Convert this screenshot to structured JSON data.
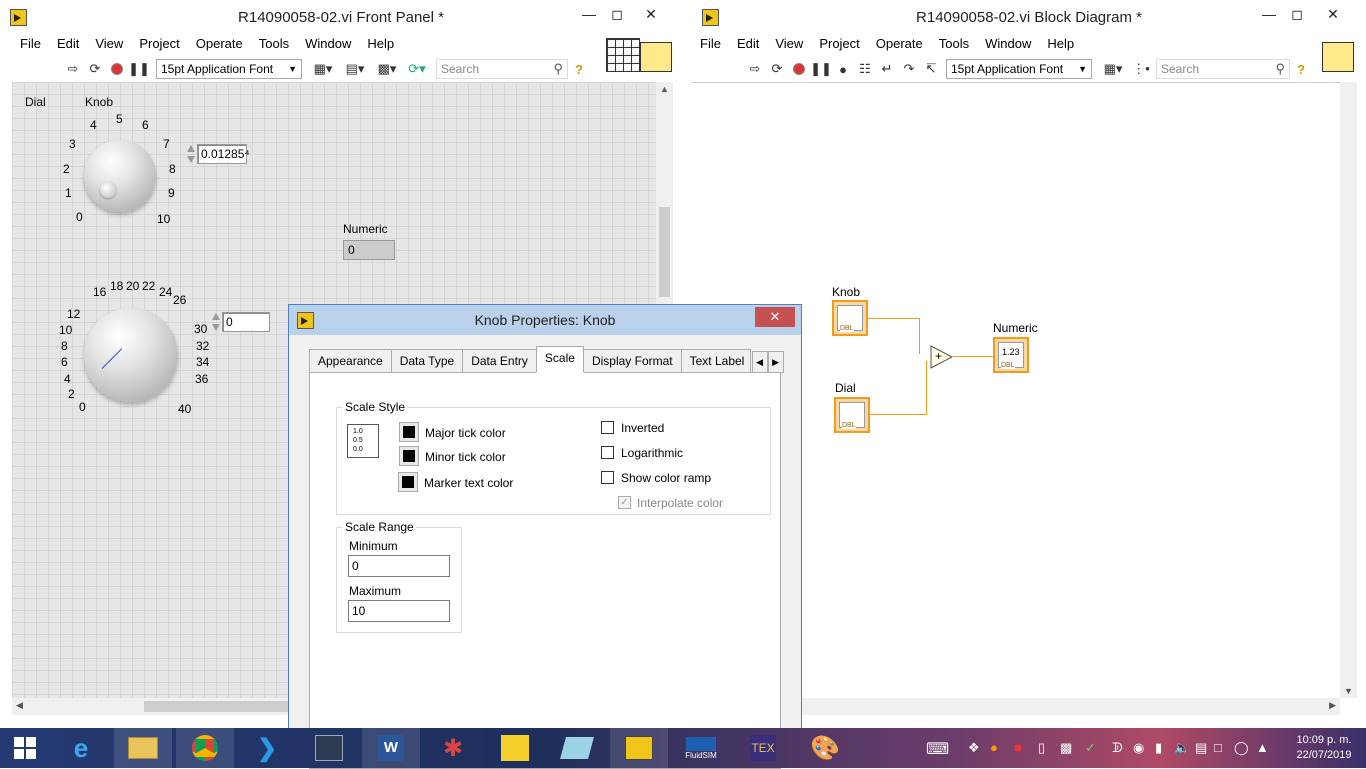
{
  "front_panel": {
    "title": "R14090058-02.vi Front Panel *",
    "menu": [
      "File",
      "Edit",
      "View",
      "Project",
      "Operate",
      "Tools",
      "Window",
      "Help"
    ],
    "font_select": "15pt Application Font",
    "search_placeholder": "Search",
    "controls": {
      "dial_label": "Dial",
      "knob_label": "Knob",
      "knob_ticks": [
        "0",
        "1",
        "2",
        "3",
        "4",
        "5",
        "6",
        "7",
        "8",
        "9",
        "10"
      ],
      "knob_value": "0.01285⁴",
      "dial_ticks": [
        "0",
        "2",
        "4",
        "6",
        "8",
        "10",
        "12",
        "16",
        "18",
        "20",
        "22",
        "24",
        "26",
        "30",
        "32",
        "34",
        "36",
        "40"
      ],
      "dial_value": "0",
      "numeric_label": "Numeric",
      "numeric_value": "0"
    }
  },
  "block_diagram": {
    "title": "R14090058-02.vi Block Diagram *",
    "menu": [
      "File",
      "Edit",
      "View",
      "Project",
      "Operate",
      "Tools",
      "Window",
      "Help"
    ],
    "font_select": "15pt Application Font",
    "search_placeholder": "Search",
    "nodes": {
      "knob_label": "Knob",
      "dial_label": "Dial",
      "numeric_label": "Numeric",
      "dbl": "DBL",
      "numeric_display": "1.23",
      "add_symbol": "+"
    }
  },
  "dialog": {
    "title": "Knob Properties: Knob",
    "close": "✕",
    "tabs": [
      "Appearance",
      "Data Type",
      "Data Entry",
      "Scale",
      "Display Format",
      "Text Label"
    ],
    "active_tab": "Scale",
    "scale_style": {
      "title": "Scale Style",
      "major_tick": "Major tick color",
      "minor_tick": "Minor tick color",
      "marker_text": "Marker text color",
      "inverted": "Inverted",
      "logarithmic": "Logarithmic",
      "show_color_ramp": "Show color ramp",
      "interpolate_color": "Interpolate color",
      "preview_lines": [
        "1.0",
        "0.5",
        "0.0"
      ]
    },
    "scale_range": {
      "title": "Scale Range",
      "minimum_label": "Minimum",
      "minimum_value": "0",
      "maximum_label": "Maximum",
      "maximum_value": "10"
    }
  },
  "taskbar": {
    "time": "10:09 p. m.",
    "date": "22/07/2019",
    "fluidsim": "FluidSIM"
  },
  "colors": {
    "accent": "#f29b1c",
    "dialog_title_bg": "#b9d1ea",
    "close_red": "#c75050"
  }
}
